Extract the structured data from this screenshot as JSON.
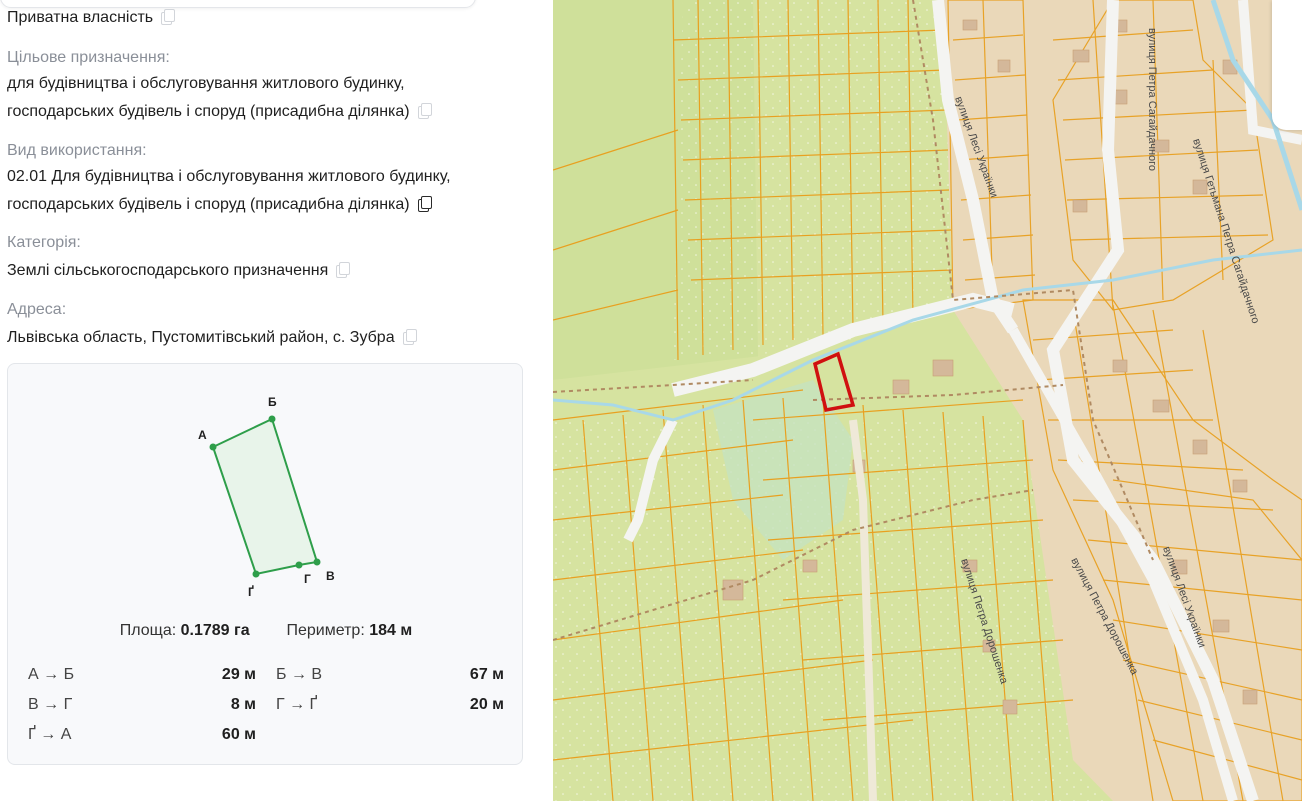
{
  "ownership": {
    "value": "Приватна власність"
  },
  "purpose": {
    "label": "Цільове призначення:",
    "line1": "для будівництва і обслуговування житлового будинку,",
    "line2": "господарських будівель і споруд (присадибна ділянка)"
  },
  "usage": {
    "label": "Вид використання:",
    "line1": "02.01 Для будівництва і обслуговування житлового будинку,",
    "line2": "господарських будівель і споруд (присадибна ділянка)"
  },
  "category": {
    "label": "Категорія:",
    "value": "Землі сільськогосподарського призначення"
  },
  "address": {
    "label": "Адреса:",
    "value": "Львівська область, Пустомитівський район, с. Зубра"
  },
  "geometry": {
    "vertices": [
      "А",
      "Б",
      "В",
      "Г",
      "Ґ"
    ],
    "area_label": "Площа:",
    "area_value": "0.1789 га",
    "perimeter_label": "Периметр:",
    "perimeter_value": "184 м",
    "sides": [
      {
        "name": "А → Б",
        "value": "29 м"
      },
      {
        "name": "Б → В",
        "value": "67 м"
      },
      {
        "name": "В → Г",
        "value": "8 м"
      },
      {
        "name": "Г → Ґ",
        "value": "20 м"
      },
      {
        "name": "Ґ → А",
        "value": "60 м"
      }
    ],
    "shape_color": "#2e9e4a"
  },
  "map": {
    "streets": [
      "вулиця Петра Сагайдачного",
      "вулиця Лесі Українки",
      "вулиця Гетьмана Петра Сагайдачного",
      "вулиця Петра Дорошенка",
      "вулиця Петра Дорошенка",
      "вулиця Лесі Українки"
    ],
    "parcel_outline_color": "#e8a020",
    "highlight_color": "#d01010",
    "field_color": "#d6e3a0",
    "residential_color": "#ead8b9",
    "road_color": "#f4f4f2",
    "water_color": "#a8d8e8"
  }
}
